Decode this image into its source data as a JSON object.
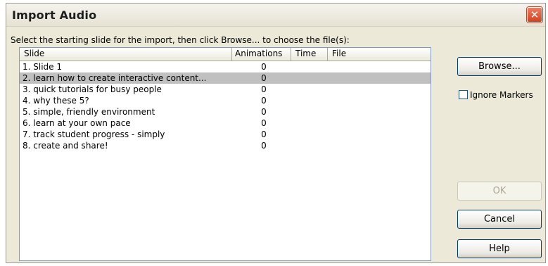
{
  "dialog": {
    "title": "Import Audio",
    "close_symbol": "✕",
    "instruction": "Select the starting slide for the import, then click Browse... to choose the file(s):"
  },
  "list": {
    "columns": [
      "Slide",
      "Animations",
      "Time",
      "File"
    ],
    "rows": [
      {
        "slide": "1. Slide 1",
        "animations": "0",
        "time": "",
        "file": ""
      },
      {
        "slide": "2. learn how to create interactive content...",
        "animations": "0",
        "time": "",
        "file": ""
      },
      {
        "slide": "3. quick tutorials for busy people",
        "animations": "0",
        "time": "",
        "file": ""
      },
      {
        "slide": "4. why these 5?",
        "animations": "0",
        "time": "",
        "file": ""
      },
      {
        "slide": "5. simple, friendly environment",
        "animations": "0",
        "time": "",
        "file": ""
      },
      {
        "slide": "6. learn at your own pace",
        "animations": "0",
        "time": "",
        "file": ""
      },
      {
        "slide": "7. track student progress - simply",
        "animations": "0",
        "time": "",
        "file": ""
      },
      {
        "slide": "8. create and share!",
        "animations": "0",
        "time": "",
        "file": ""
      }
    ],
    "selected_index": 1
  },
  "buttons": {
    "browse": "Browse...",
    "ok": "OK",
    "cancel": "Cancel",
    "help": "Help"
  },
  "ignore_markers": {
    "label": "Ignore Markers",
    "checked": false
  },
  "colors": {
    "dialog_bg": "#ece9d8",
    "selected_row": "#c0c0c0",
    "close_button": "#d4401e"
  },
  "icons": {
    "close": "close-icon"
  }
}
